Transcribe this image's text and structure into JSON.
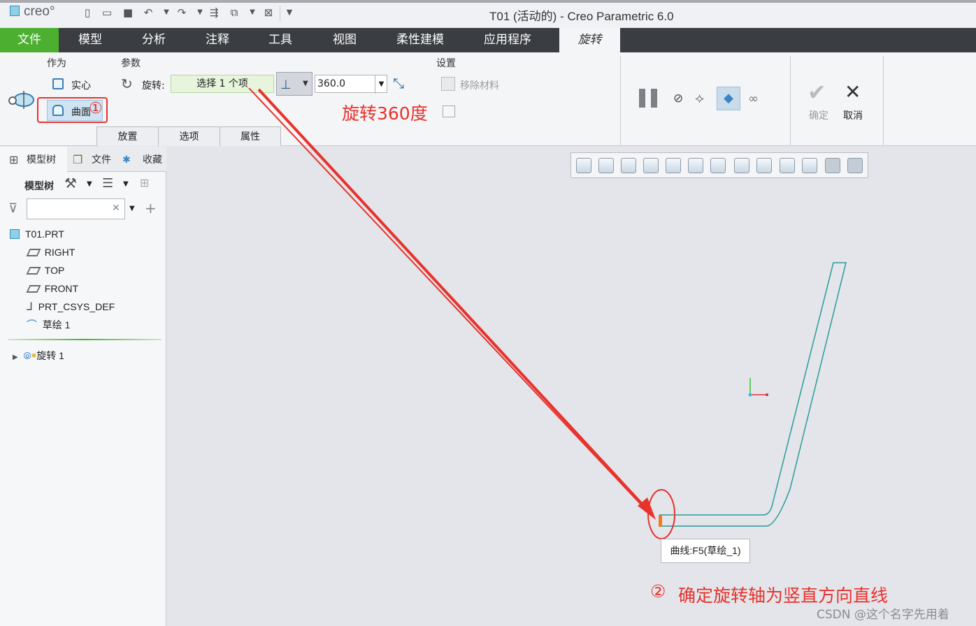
{
  "app": {
    "logo_text": "creo°",
    "window_title": "T01 (活动的) - Creo Parametric 6.0"
  },
  "ribbon_tabs": [
    "文件",
    "模型",
    "分析",
    "注释",
    "工具",
    "视图",
    "柔性建模",
    "应用程序",
    "旋转"
  ],
  "ribbon": {
    "group_type": "作为",
    "solid_label": "实心",
    "surface_label": "曲面",
    "group_params": "参数",
    "rotate_label": "旋转:",
    "select_placeholder": "选择 1 个项",
    "angle_value": "360.0",
    "group_settings": "设置",
    "remove_material": "移除材料",
    "confirm_label": "确定",
    "cancel_label": "取消",
    "subtabs": [
      "放置",
      "选项",
      "属性"
    ]
  },
  "left_panel": {
    "tabs": [
      "模型树",
      "文件",
      "收藏"
    ],
    "tree_header": "模型树",
    "tree": [
      {
        "label": "T01.PRT"
      },
      {
        "label": "RIGHT"
      },
      {
        "label": "TOP"
      },
      {
        "label": "FRONT"
      },
      {
        "label": "PRT_CSYS_DEF"
      },
      {
        "label": "草绘 1"
      },
      {
        "label": "旋转 1"
      }
    ]
  },
  "viewport": {
    "tooltip": "曲线:F5(草绘_1)"
  },
  "annotations": {
    "marker_1": "①",
    "rotate_360": "旋转360度",
    "marker_2": "②",
    "axis_note": "确定旋转轴为竖直方向直线"
  },
  "watermark": "CSDN @这个名字先用着",
  "colors": {
    "file_tab": "#4caf30",
    "annotation_red": "#e8322c",
    "curve": "#2a9a9a"
  }
}
